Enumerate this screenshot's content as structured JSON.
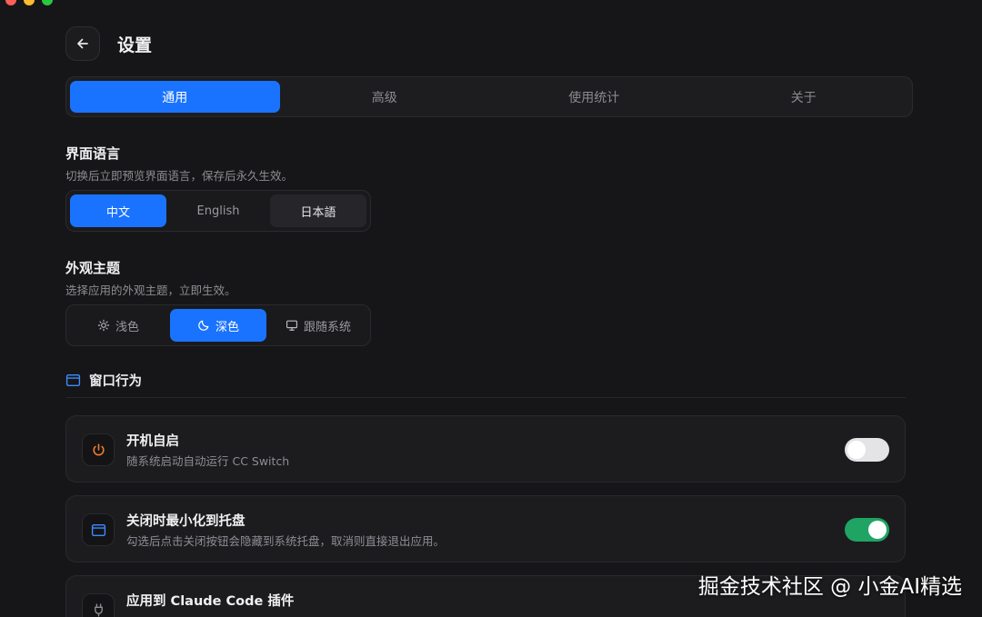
{
  "header": {
    "title": "设置"
  },
  "tabs": [
    {
      "label": "通用",
      "active": true
    },
    {
      "label": "高级",
      "active": false
    },
    {
      "label": "使用统计",
      "active": false
    },
    {
      "label": "关于",
      "active": false
    }
  ],
  "language": {
    "title": "界面语言",
    "description": "切换后立即预览界面语言，保存后永久生效。",
    "options": [
      {
        "label": "中文",
        "state": "active"
      },
      {
        "label": "English",
        "state": "default"
      },
      {
        "label": "日本語",
        "state": "muted"
      }
    ]
  },
  "theme": {
    "title": "外观主题",
    "description": "选择应用的外观主题，立即生效。",
    "options": [
      {
        "label": "浅色",
        "icon": "sun-icon",
        "state": "default"
      },
      {
        "label": "深色",
        "icon": "moon-icon",
        "state": "active"
      },
      {
        "label": "跟随系统",
        "icon": "monitor-icon",
        "state": "default"
      }
    ]
  },
  "window_behavior": {
    "title": "窗口行为",
    "icon": "window-icon",
    "items": [
      {
        "title": "开机自启",
        "description": "随系统启动自动运行 CC Switch",
        "icon": "power-icon",
        "enabled": false
      },
      {
        "title": "关闭时最小化到托盘",
        "description": "勾选后点击关闭按钮会隐藏到系统托盘，取消则直接退出应用。",
        "icon": "window-icon",
        "enabled": true
      },
      {
        "title": "应用到 Claude Code 插件",
        "description": "",
        "icon": "plug-icon",
        "enabled": false
      }
    ]
  },
  "watermark": "掘金技术社区 @ 小金AI精选",
  "colors": {
    "accent": "#1a73ff",
    "toggle_on": "#1fa463",
    "power_icon": "#f07a2c",
    "background": "#161618"
  }
}
